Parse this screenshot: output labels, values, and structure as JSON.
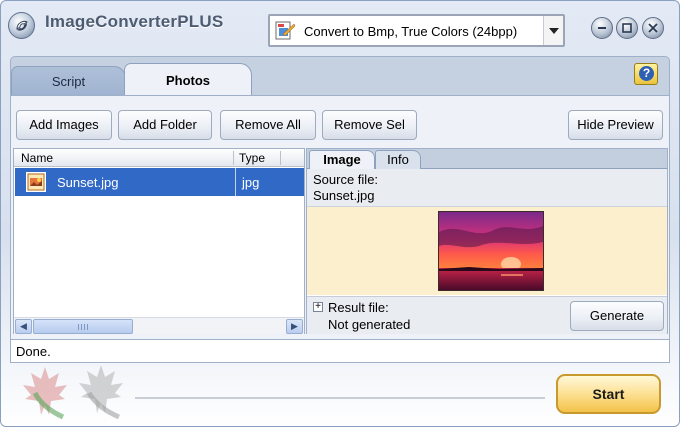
{
  "window": {
    "title": "ImageConverterPLUS",
    "convert_preset": "Convert to Bmp, True Colors (24bpp)"
  },
  "tabs": [
    {
      "label": "Script",
      "active": false
    },
    {
      "label": "Photos",
      "active": true
    }
  ],
  "help": {
    "icon": "help-icon",
    "glyph": "?"
  },
  "toolbar": {
    "add_images": "Add Images",
    "add_folder": "Add Folder",
    "remove_all": "Remove All",
    "remove_sel": "Remove Sel",
    "hide_preview": "Hide Preview"
  },
  "file_list": {
    "columns": [
      "Name",
      "Type"
    ],
    "rows": [
      {
        "name": "Sunset.jpg",
        "type": "jpg",
        "selected": true
      }
    ],
    "scroll_grip": "III"
  },
  "preview": {
    "tabs": [
      {
        "label": "Image",
        "active": true
      },
      {
        "label": "Info",
        "active": false
      }
    ],
    "source_label": "Source file:",
    "source_value": "Sunset.jpg",
    "result_label": "Result file:",
    "result_value": "Not generated",
    "expander": "+",
    "generate_label": "Generate"
  },
  "status": {
    "text": "Done."
  },
  "start_label": "Start",
  "colors": {
    "selection": "#3169c6",
    "preview_background": "#fbefcd",
    "start_button": "#f3c24a"
  }
}
